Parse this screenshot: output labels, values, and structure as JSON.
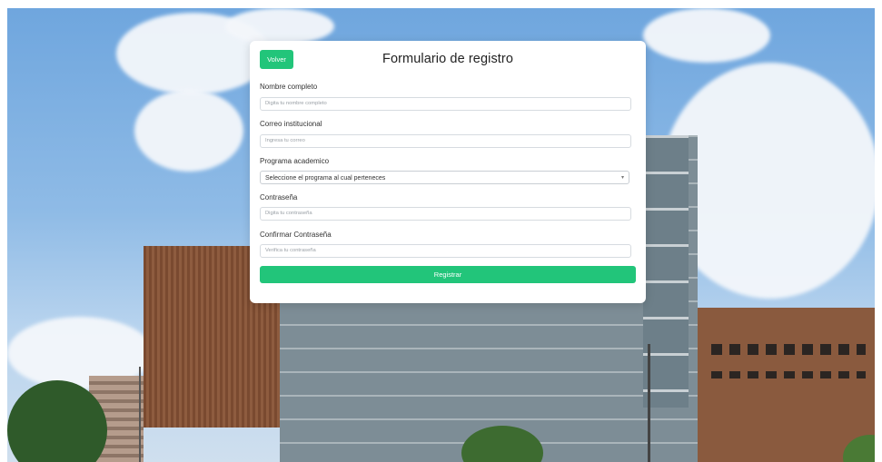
{
  "form": {
    "back_button": "Volver",
    "title": "Formulario de registro",
    "fields": [
      {
        "label": "Nombre completo",
        "placeholder": "Digita tu nombre completo"
      },
      {
        "label": "Correo institucional",
        "placeholder": "Ingresa tu correo"
      },
      {
        "label": "Programa academico",
        "selected": "Seleccione el programa al cual perteneces"
      },
      {
        "label": "Contraseña",
        "placeholder": "Digita tu contraseña"
      },
      {
        "label": "Confirmar Contraseña",
        "placeholder": "Verifica tu contraseña"
      }
    ],
    "submit_button": "Registrar"
  },
  "colors": {
    "accent": "#22c57a",
    "sky": "#7aaee2"
  },
  "icons": {
    "select": "chevron-down-icon"
  }
}
